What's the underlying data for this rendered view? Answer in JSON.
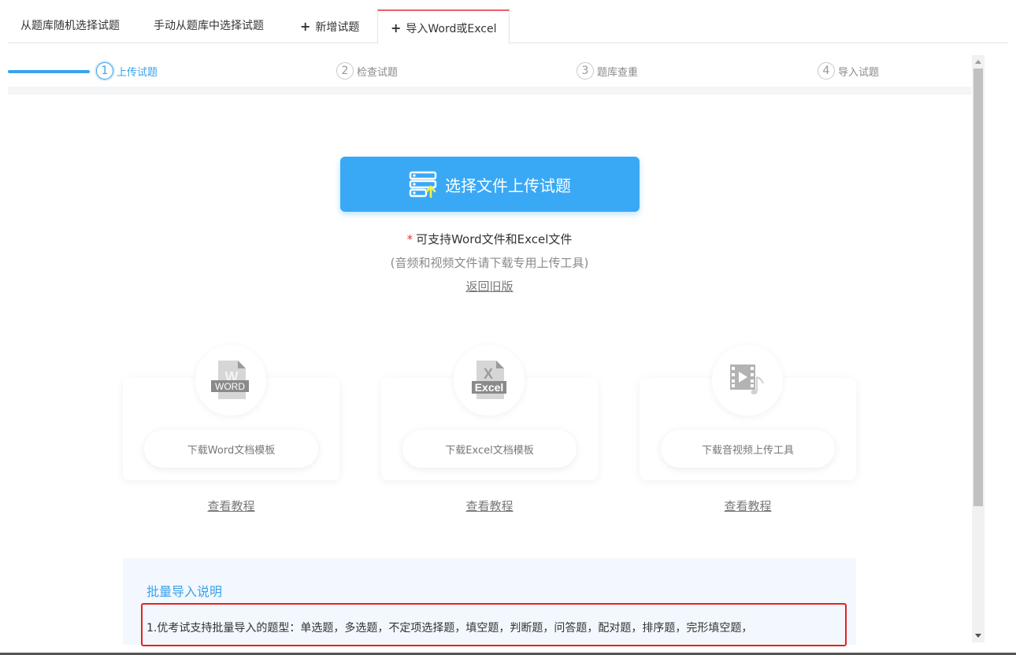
{
  "tabs": [
    {
      "label": "从题库随机选择试题",
      "plus": ""
    },
    {
      "label": "手动从题库中选择试题",
      "plus": ""
    },
    {
      "label": "新增试题",
      "plus": "+"
    },
    {
      "label": "导入Word或Excel",
      "plus": "+"
    }
  ],
  "steps": [
    {
      "num": "1",
      "label": "上传试题"
    },
    {
      "num": "2",
      "label": "检查试题"
    },
    {
      "num": "3",
      "label": "题库查重"
    },
    {
      "num": "4",
      "label": "导入试题"
    }
  ],
  "upload": {
    "button_label": "选择文件上传试题",
    "required_mark": "*",
    "support_text": "可支持Word文件和Excel文件",
    "note": "(音频和视频文件请下载专用上传工具)",
    "old_version_link": "返回旧版"
  },
  "cards": [
    {
      "icon_badge": "WORD",
      "icon_letter": "W",
      "button_label": "下载Word文档模板",
      "tutorial": "查看教程"
    },
    {
      "icon_badge": "Excel",
      "icon_letter": "X",
      "button_label": "下载Excel文档模板",
      "tutorial": "查看教程"
    },
    {
      "button_label": "下载音视频上传工具",
      "tutorial": "查看教程"
    }
  ],
  "info": {
    "title": "批量导入说明",
    "line1": "1.优考试支持批量导入的题型：单选题，多选题，不定项选择题，填空题，判断题，问答题，配对题，排序题，完形填空题，"
  },
  "colors": {
    "accent": "#3aa2eb",
    "upload_button": "#3aa9f5",
    "active_tab_border": "#ee5d6a",
    "highlight_border": "#e8211e"
  }
}
